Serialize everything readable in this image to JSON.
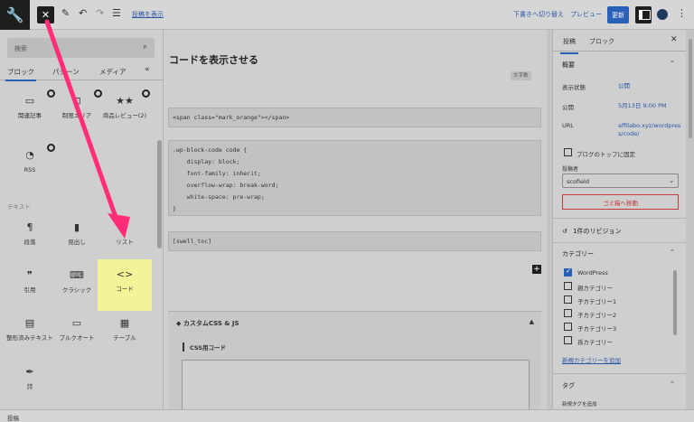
{
  "topbar": {
    "close_glyph": "✕",
    "view_post_label": "投稿を表示",
    "draft_label": "下書きへ切り替え",
    "preview_label": "プレビュー",
    "update_label": "更新"
  },
  "inserter": {
    "search_placeholder": "検索",
    "tabs": [
      "ブロック",
      "パターン",
      "メディア"
    ],
    "section_text": "テキスト",
    "blocks": [
      {
        "label": "関連記事",
        "icon": "related-posts-icon"
      },
      {
        "label": "制限エリア",
        "icon": "restricted-area-icon"
      },
      {
        "label": "商品レビュー(2)",
        "icon": "product-review-icon"
      },
      {
        "label": "RSS",
        "icon": "rss-icon"
      },
      {
        "label": "段落",
        "icon": "paragraph-icon"
      },
      {
        "label": "見出し",
        "icon": "heading-icon"
      },
      {
        "label": "リスト",
        "icon": "list-icon"
      },
      {
        "label": "引用",
        "icon": "quote-icon"
      },
      {
        "label": "クラシック",
        "icon": "classic-icon"
      },
      {
        "label": "コード",
        "icon": "code-icon"
      },
      {
        "label": "整形済みテキスト",
        "icon": "preformatted-icon"
      },
      {
        "label": "プルクオート",
        "icon": "pullquote-icon"
      },
      {
        "label": "テーブル",
        "icon": "table-icon"
      },
      {
        "label": "詩",
        "icon": "verse-icon"
      }
    ]
  },
  "editor": {
    "title": "コードを表示させる",
    "word_count_label": "文字数",
    "code_blocks": [
      [
        "<span class=\"mark_orange\"></span>"
      ],
      [
        ".wp-block-code code {",
        "    display: block;",
        "    font-family: inherit;",
        "    overflow-wrap: break-word;",
        "    white-space: pre-wrap;",
        "}"
      ],
      [
        "[swell_toc]"
      ]
    ],
    "custom_css_heading": "カスタムCSS & JS",
    "css_for_label": "CSS用コード"
  },
  "sidebar": {
    "tabs": [
      "投稿",
      "ブロック"
    ],
    "summary_heading": "概要",
    "visibility_label": "表示状態",
    "visibility_value": "公開",
    "publish_label": "公開",
    "publish_value": "5月13日 9:00 PM",
    "url_label": "URL",
    "url_value_1": "affilabo.xyz/wordpres",
    "url_value_2": "s/code/",
    "sticky_label": "ブログのトップに固定",
    "author_label": "投稿者",
    "author_value": "scofield",
    "trash_label": "ゴミ箱へ移動",
    "revisions_label": "1件のリビジョン",
    "categories_heading": "カテゴリー",
    "categories": [
      {
        "label": "WordPress",
        "checked": true
      },
      {
        "label": "親カテゴリー",
        "checked": false
      },
      {
        "label": "子カテゴリー1",
        "checked": false
      },
      {
        "label": "子カテゴリー2",
        "checked": false
      },
      {
        "label": "子カテゴリー3",
        "checked": false
      },
      {
        "label": "孫カテゴリー",
        "checked": false
      }
    ],
    "add_category_label": "新規カテゴリーを追加",
    "tags_heading": "タグ",
    "add_tag_label": "新規タグを追加"
  },
  "footer": {
    "breadcrumb": "投稿"
  },
  "colors": {
    "accent": "#2a61b8",
    "highlight": "#f3f39a",
    "arrow": "#ff2d78",
    "danger": "#c23a3a"
  }
}
